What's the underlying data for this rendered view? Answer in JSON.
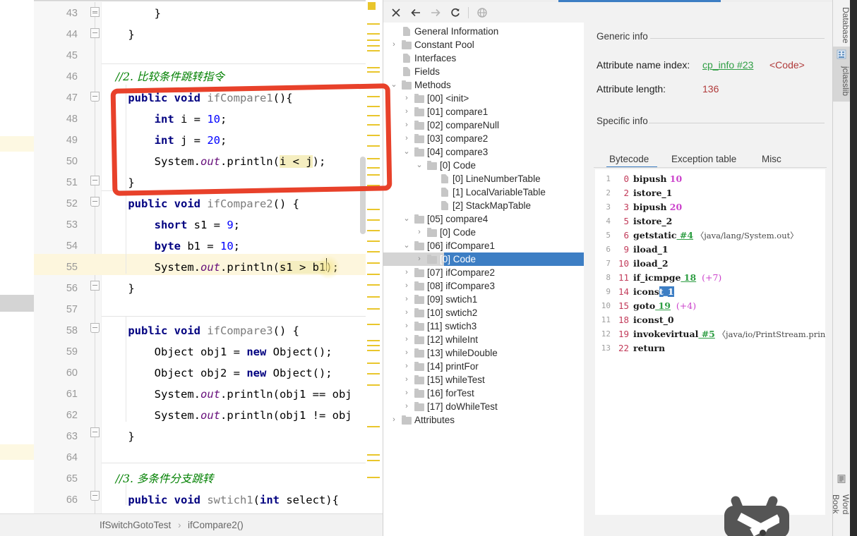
{
  "editor": {
    "first_line": 43,
    "lines": [
      {
        "n": 43,
        "indent": 3,
        "tokens": [
          {
            "t": "        }",
            "c": "plain"
          }
        ]
      },
      {
        "n": 44,
        "indent": 2,
        "tokens": [
          {
            "t": "    }",
            "c": "plain"
          }
        ]
      },
      {
        "n": 45,
        "indent": 0,
        "tokens": []
      },
      {
        "n": 46,
        "indent": 1,
        "tokens": [
          {
            "t": "    //2. 比较条件跳转指令",
            "c": "cmt"
          }
        ]
      },
      {
        "n": 47,
        "indent": 1,
        "tokens": [
          {
            "t": "    ",
            "c": "plain"
          },
          {
            "t": "public void ",
            "c": "kw"
          },
          {
            "t": "ifCompare1",
            "c": "mth"
          },
          {
            "t": "(){",
            "c": "plain"
          }
        ]
      },
      {
        "n": 48,
        "indent": 2,
        "tokens": [
          {
            "t": "        ",
            "c": "plain"
          },
          {
            "t": "int",
            "c": "kw"
          },
          {
            "t": " i = ",
            "c": "plain"
          },
          {
            "t": "10",
            "c": "num"
          },
          {
            "t": ";",
            "c": "plain"
          }
        ]
      },
      {
        "n": 49,
        "indent": 2,
        "tokens": [
          {
            "t": "        ",
            "c": "plain"
          },
          {
            "t": "int",
            "c": "kw"
          },
          {
            "t": " j = ",
            "c": "plain"
          },
          {
            "t": "20",
            "c": "num"
          },
          {
            "t": ";",
            "c": "plain"
          }
        ]
      },
      {
        "n": 50,
        "indent": 2,
        "tokens": [
          {
            "t": "        System.",
            "c": "plain"
          },
          {
            "t": "out",
            "c": "fld"
          },
          {
            "t": ".println(",
            "c": "plain"
          },
          {
            "t": "i < j",
            "c": "sel"
          },
          {
            "t": ");",
            "c": "plain"
          }
        ]
      },
      {
        "n": 51,
        "indent": 1,
        "tokens": [
          {
            "t": "    }",
            "c": "plain"
          }
        ]
      },
      {
        "n": 52,
        "indent": 1,
        "tokens": [
          {
            "t": "    ",
            "c": "plain"
          },
          {
            "t": "public void ",
            "c": "kw"
          },
          {
            "t": "ifCompare2",
            "c": "mth"
          },
          {
            "t": "() {",
            "c": "plain"
          }
        ]
      },
      {
        "n": 53,
        "indent": 2,
        "tokens": [
          {
            "t": "        ",
            "c": "plain"
          },
          {
            "t": "short",
            "c": "kw"
          },
          {
            "t": " s1 = ",
            "c": "plain"
          },
          {
            "t": "9",
            "c": "num"
          },
          {
            "t": ";",
            "c": "plain"
          }
        ]
      },
      {
        "n": 54,
        "indent": 2,
        "tokens": [
          {
            "t": "        ",
            "c": "plain"
          },
          {
            "t": "byte",
            "c": "kw"
          },
          {
            "t": " b1 = ",
            "c": "plain"
          },
          {
            "t": "10",
            "c": "num"
          },
          {
            "t": ";",
            "c": "plain"
          }
        ]
      },
      {
        "n": 55,
        "indent": 2,
        "tokens": [
          {
            "t": "        System.",
            "c": "plain"
          },
          {
            "t": "out",
            "c": "fld"
          },
          {
            "t": ".println(",
            "c": "plain"
          },
          {
            "t": "s1 > b1",
            "c": "sel"
          },
          {
            "t": ");",
            "c": "plain"
          }
        ]
      },
      {
        "n": 56,
        "indent": 1,
        "tokens": [
          {
            "t": "    }",
            "c": "plain"
          }
        ]
      },
      {
        "n": 57,
        "indent": 0,
        "tokens": []
      },
      {
        "n": 58,
        "indent": 1,
        "tokens": [
          {
            "t": "    ",
            "c": "plain"
          },
          {
            "t": "public void ",
            "c": "kw"
          },
          {
            "t": "ifCompare3",
            "c": "mth"
          },
          {
            "t": "() {",
            "c": "plain"
          }
        ]
      },
      {
        "n": 59,
        "indent": 2,
        "tokens": [
          {
            "t": "        Object obj1 = ",
            "c": "plain"
          },
          {
            "t": "new",
            "c": "kw"
          },
          {
            "t": " Object();",
            "c": "plain"
          }
        ]
      },
      {
        "n": 60,
        "indent": 2,
        "tokens": [
          {
            "t": "        Object obj2 = ",
            "c": "plain"
          },
          {
            "t": "new",
            "c": "kw"
          },
          {
            "t": " Object();",
            "c": "plain"
          }
        ]
      },
      {
        "n": 61,
        "indent": 2,
        "tokens": [
          {
            "t": "        System.",
            "c": "plain"
          },
          {
            "t": "out",
            "c": "fld"
          },
          {
            "t": ".println(obj1 == obj",
            "c": "plain"
          }
        ]
      },
      {
        "n": 62,
        "indent": 2,
        "tokens": [
          {
            "t": "        System.",
            "c": "plain"
          },
          {
            "t": "out",
            "c": "fld"
          },
          {
            "t": ".println(obj1 != obj",
            "c": "plain"
          }
        ]
      },
      {
        "n": 63,
        "indent": 1,
        "tokens": [
          {
            "t": "    }",
            "c": "plain"
          }
        ]
      },
      {
        "n": 64,
        "indent": 0,
        "tokens": []
      },
      {
        "n": 65,
        "indent": 1,
        "tokens": [
          {
            "t": "    //3. 多条件分支跳转",
            "c": "cmt"
          }
        ]
      },
      {
        "n": 66,
        "indent": 1,
        "tokens": [
          {
            "t": "    ",
            "c": "plain"
          },
          {
            "t": "public void ",
            "c": "kw"
          },
          {
            "t": "swtich1",
            "c": "mth"
          },
          {
            "t": "(",
            "c": "plain"
          },
          {
            "t": "int",
            "c": "kw"
          },
          {
            "t": " select){",
            "c": "plain"
          }
        ]
      }
    ],
    "current_line": 55,
    "breadcrumb": {
      "class_name": "IfSwitchGotoTest",
      "separator": "›",
      "method_name": "ifCompare2()"
    }
  },
  "toolwindow": {
    "toolbar": {
      "close_label": "✕",
      "back_label": "←",
      "forward_label": "→",
      "reload_label": "⟳",
      "browse_label": "browse-icon"
    },
    "tree": [
      {
        "depth": 0,
        "label": "General Information",
        "icon": "doc",
        "arrow": "",
        "state": ""
      },
      {
        "depth": 0,
        "label": "Constant Pool",
        "icon": "folder",
        "arrow": "›",
        "state": ""
      },
      {
        "depth": 0,
        "label": "Interfaces",
        "icon": "doc",
        "arrow": "",
        "state": ""
      },
      {
        "depth": 0,
        "label": "Fields",
        "icon": "doc",
        "arrow": "",
        "state": ""
      },
      {
        "depth": 0,
        "label": "Methods",
        "icon": "folder",
        "arrow": "⌄",
        "state": ""
      },
      {
        "depth": 1,
        "label": "[00] <init>",
        "icon": "folder",
        "arrow": "›",
        "state": ""
      },
      {
        "depth": 1,
        "label": "[01] compare1",
        "icon": "folder",
        "arrow": "›",
        "state": ""
      },
      {
        "depth": 1,
        "label": "[02] compareNull",
        "icon": "folder",
        "arrow": "›",
        "state": ""
      },
      {
        "depth": 1,
        "label": "[03] compare2",
        "icon": "folder",
        "arrow": "›",
        "state": ""
      },
      {
        "depth": 1,
        "label": "[04] compare3",
        "icon": "folder",
        "arrow": "⌄",
        "state": ""
      },
      {
        "depth": 2,
        "label": "[0] Code",
        "icon": "folder",
        "arrow": "⌄",
        "state": ""
      },
      {
        "depth": 3,
        "label": "[0] LineNumberTable",
        "icon": "doc",
        "arrow": "",
        "state": ""
      },
      {
        "depth": 3,
        "label": "[1] LocalVariableTable",
        "icon": "doc",
        "arrow": "",
        "state": ""
      },
      {
        "depth": 3,
        "label": "[2] StackMapTable",
        "icon": "doc",
        "arrow": "",
        "state": ""
      },
      {
        "depth": 1,
        "label": "[05] compare4",
        "icon": "folder",
        "arrow": "⌄",
        "state": ""
      },
      {
        "depth": 2,
        "label": "[0] Code",
        "icon": "folder",
        "arrow": "›",
        "state": ""
      },
      {
        "depth": 1,
        "label": "[06] ifCompare1",
        "icon": "folder",
        "arrow": "⌄",
        "state": ""
      },
      {
        "depth": 2,
        "label": "[0] Code",
        "icon": "folder",
        "arrow": "›",
        "state": "selected"
      },
      {
        "depth": 1,
        "label": "[07] ifCompare2",
        "icon": "folder",
        "arrow": "›",
        "state": ""
      },
      {
        "depth": 1,
        "label": "[08] ifCompare3",
        "icon": "folder",
        "arrow": "›",
        "state": ""
      },
      {
        "depth": 1,
        "label": "[09] swtich1",
        "icon": "folder",
        "arrow": "›",
        "state": ""
      },
      {
        "depth": 1,
        "label": "[10] swtich2",
        "icon": "folder",
        "arrow": "›",
        "state": ""
      },
      {
        "depth": 1,
        "label": "[11] swtich3",
        "icon": "folder",
        "arrow": "›",
        "state": ""
      },
      {
        "depth": 1,
        "label": "[12] whileInt",
        "icon": "folder",
        "arrow": "›",
        "state": ""
      },
      {
        "depth": 1,
        "label": "[13] whileDouble",
        "icon": "folder",
        "arrow": "›",
        "state": ""
      },
      {
        "depth": 1,
        "label": "[14] printFor",
        "icon": "folder",
        "arrow": "›",
        "state": ""
      },
      {
        "depth": 1,
        "label": "[15] whileTest",
        "icon": "folder",
        "arrow": "›",
        "state": ""
      },
      {
        "depth": 1,
        "label": "[16] forTest",
        "icon": "folder",
        "arrow": "›",
        "state": ""
      },
      {
        "depth": 1,
        "label": "[17] doWhileTest",
        "icon": "folder",
        "arrow": "›",
        "state": ""
      },
      {
        "depth": 0,
        "label": "Attributes",
        "icon": "folder",
        "arrow": "›",
        "state": ""
      }
    ],
    "detail": {
      "generic_info_title": "Generic info",
      "specific_info_title": "Specific info",
      "attribute_name_index_label": "Attribute name index:",
      "attribute_name_index_link": "cp_info #23",
      "attribute_name_index_value": "<Code>",
      "attribute_length_label": "Attribute length:",
      "attribute_length_value": "136",
      "tabs": [
        {
          "label": "Bytecode",
          "active": true
        },
        {
          "label": "Exception table",
          "active": false
        },
        {
          "label": "Misc",
          "active": false
        }
      ],
      "bytecode": [
        {
          "ln": "1",
          "offset": "0",
          "mnemonic": "bipush",
          "imm": "10",
          "ref": "",
          "delta": "",
          "desc": ""
        },
        {
          "ln": "2",
          "offset": "2",
          "mnemonic": "istore_1",
          "imm": "",
          "ref": "",
          "delta": "",
          "desc": ""
        },
        {
          "ln": "3",
          "offset": "3",
          "mnemonic": "bipush",
          "imm": "20",
          "ref": "",
          "delta": "",
          "desc": ""
        },
        {
          "ln": "4",
          "offset": "5",
          "mnemonic": "istore_2",
          "imm": "",
          "ref": "",
          "delta": "",
          "desc": ""
        },
        {
          "ln": "5",
          "offset": "6",
          "mnemonic": "getstatic",
          "imm": "",
          "ref": "#4",
          "delta": "",
          "desc": "〈java/lang/System.out〉"
        },
        {
          "ln": "6",
          "offset": "9",
          "mnemonic": "iload_1",
          "imm": "",
          "ref": "",
          "delta": "",
          "desc": ""
        },
        {
          "ln": "7",
          "offset": "10",
          "mnemonic": "iload_2",
          "imm": "",
          "ref": "",
          "delta": "",
          "desc": ""
        },
        {
          "ln": "8",
          "offset": "11",
          "mnemonic": "if_icmpge",
          "imm": "",
          "ref": "18",
          "delta": "(+7)",
          "desc": ""
        },
        {
          "ln": "9",
          "offset": "14",
          "mnemonic": "iconst_1",
          "imm": "",
          "ref": "",
          "delta": "",
          "desc": "",
          "selection": "t_1"
        },
        {
          "ln": "10",
          "offset": "15",
          "mnemonic": "goto",
          "imm": "",
          "ref": "19",
          "delta": "(+4)",
          "desc": ""
        },
        {
          "ln": "11",
          "offset": "18",
          "mnemonic": "iconst_0",
          "imm": "",
          "ref": "",
          "delta": "",
          "desc": ""
        },
        {
          "ln": "12",
          "offset": "19",
          "mnemonic": "invokevirtual",
          "imm": "",
          "ref": "#5",
          "delta": "",
          "desc": "〈java/io/PrintStream.print"
        },
        {
          "ln": "13",
          "offset": "22",
          "mnemonic": "return",
          "imm": "",
          "ref": "",
          "delta": "",
          "desc": ""
        }
      ]
    }
  },
  "right_strip": {
    "tabs": [
      {
        "label": "Database",
        "active": false,
        "icon": ""
      },
      {
        "label": "jclasslib",
        "active": true,
        "icon": "jclasslib-icon"
      },
      {
        "label": "Word Book",
        "active": false,
        "icon": "book-icon"
      }
    ]
  },
  "annotation": {
    "color": "#e8412a",
    "shape": "rounded-rectangle"
  }
}
